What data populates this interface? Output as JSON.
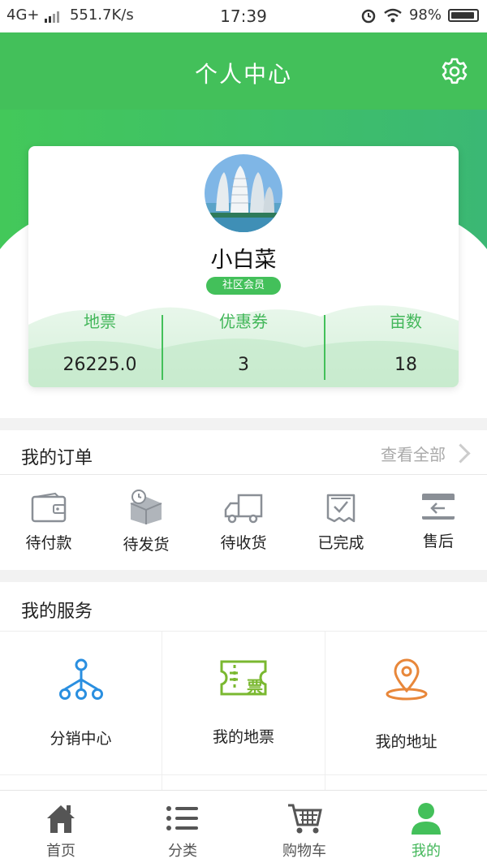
{
  "status_bar": {
    "network": "4G+",
    "speed": "551.7K/s",
    "time": "17:39",
    "battery": "98%"
  },
  "header": {
    "title": "个人中心",
    "settings_icon": "gear-icon"
  },
  "profile": {
    "username": "小白菜",
    "badge": "社区会员",
    "stats": [
      {
        "label": "地票",
        "value": "26225.0"
      },
      {
        "label": "优惠券",
        "value": "3"
      },
      {
        "label": "亩数",
        "value": "18"
      }
    ]
  },
  "orders": {
    "title": "我的订单",
    "view_all": "查看全部",
    "items": [
      {
        "label": "待付款",
        "icon": "wallet-icon"
      },
      {
        "label": "待发货",
        "icon": "package-clock-icon"
      },
      {
        "label": "待收货",
        "icon": "truck-icon"
      },
      {
        "label": "已完成",
        "icon": "receipt-check-icon"
      },
      {
        "label": "售后",
        "icon": "card-return-icon"
      }
    ]
  },
  "services": {
    "title": "我的服务",
    "items": [
      {
        "label": "分销中心",
        "icon": "network-icon"
      },
      {
        "label": "我的地票",
        "icon": "ticket-icon",
        "icon_text": "票"
      },
      {
        "label": "我的地址",
        "icon": "location-pin-icon"
      }
    ]
  },
  "tabbar": {
    "items": [
      {
        "label": "首页",
        "icon": "home-icon"
      },
      {
        "label": "分类",
        "icon": "list-icon"
      },
      {
        "label": "购物车",
        "icon": "cart-icon"
      },
      {
        "label": "我的",
        "icon": "user-icon",
        "active": true
      }
    ]
  },
  "colors": {
    "brand_green": "#43c05a",
    "stat_label_green": "#43b75a",
    "service_blue": "#2a8fe0",
    "service_green": "#7ab830",
    "service_orange": "#e8873a"
  }
}
